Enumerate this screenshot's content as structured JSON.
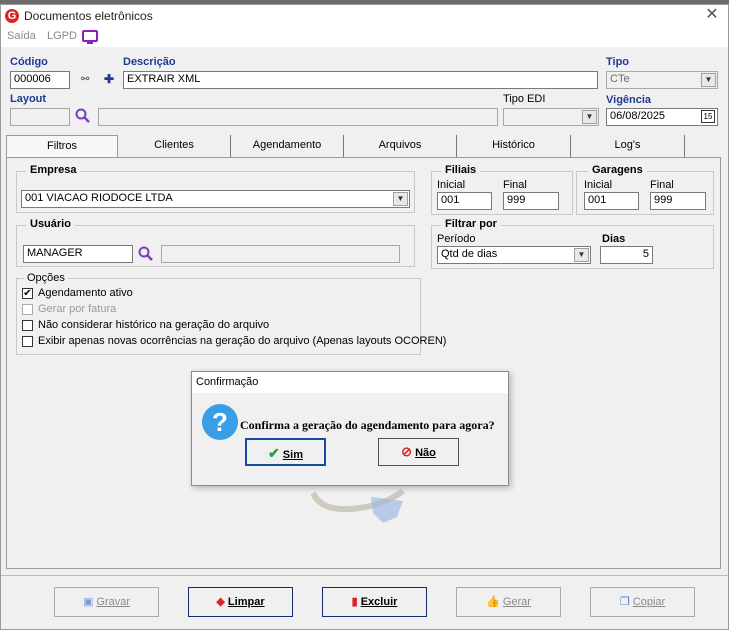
{
  "window": {
    "title": "Documentos eletrônicos",
    "close_glyph": "✕"
  },
  "menu": {
    "items": [
      "Saída",
      "LGPD"
    ]
  },
  "form": {
    "codigo_label": "Código",
    "codigo_value": "000006",
    "descricao_label": "Descrição",
    "descricao_value": "EXTRAIR XML",
    "tipo_label": "Tipo",
    "tipo_value": "CTe",
    "layout_label": "Layout",
    "layout_value": "",
    "layout_desc": "",
    "tipo_edi_label": "Tipo EDI",
    "tipo_edi_value": "",
    "vigencia_label": "Vigência",
    "vigencia_value": "06/08/2025",
    "plus_glyph": "✚",
    "binoculars_glyph": "⚯",
    "calendar_glyph": "15"
  },
  "tabs": [
    "Filtros",
    "Clientes",
    "Agendamento",
    "Arquivos",
    "Histórico",
    "Log's"
  ],
  "filtros": {
    "empresa_title": "Empresa",
    "empresa_value": "001 VIACAO RIODOCE LTDA",
    "filiais_title": "Filiais",
    "filiais_inicial_label": "Inicial",
    "filiais_final_label": "Final",
    "filiais_inicial": "001",
    "filiais_final": "999",
    "garagens_title": "Garagens",
    "garagens_inicial_label": "Inicial",
    "garagens_final_label": "Final",
    "garagens_inicial": "001",
    "garagens_final": "999",
    "usuario_title": "Usuário",
    "usuario_value": "MANAGER",
    "usuario_desc": "",
    "filtrar_title": "Filtrar por",
    "periodo_label": "Período",
    "periodo_value": "Qtd de dias",
    "dias_label": "Dias",
    "dias_value": "5",
    "opcoes_title": "Opções",
    "opcoes": [
      {
        "label": "Agendamento ativo",
        "checked": true,
        "enabled": true
      },
      {
        "label": "Gerar por fatura",
        "checked": false,
        "enabled": false
      },
      {
        "label": "Não considerar histórico na geração do arquivo",
        "checked": false,
        "enabled": true
      },
      {
        "label": "Exibir apenas novas ocorrências na geração do arquivo (Apenas layouts OCOREN)",
        "checked": false,
        "enabled": true
      }
    ]
  },
  "buttons": {
    "gravar": "Gravar",
    "limpar": "Limpar",
    "excluir": "Excluir",
    "gerar": "Gerar",
    "copiar": "Copiar"
  },
  "dialog": {
    "title": "Confirmação",
    "message": "Confirma a geração do agendamento para agora?",
    "yes": "Sim",
    "no": "Não",
    "icon_glyph": "?"
  },
  "colors": {
    "label_blue": "#1f3a93",
    "accent_purple": "#8b1fc4",
    "brand_red": "#d62828",
    "question_blue": "#3a9ee4"
  }
}
